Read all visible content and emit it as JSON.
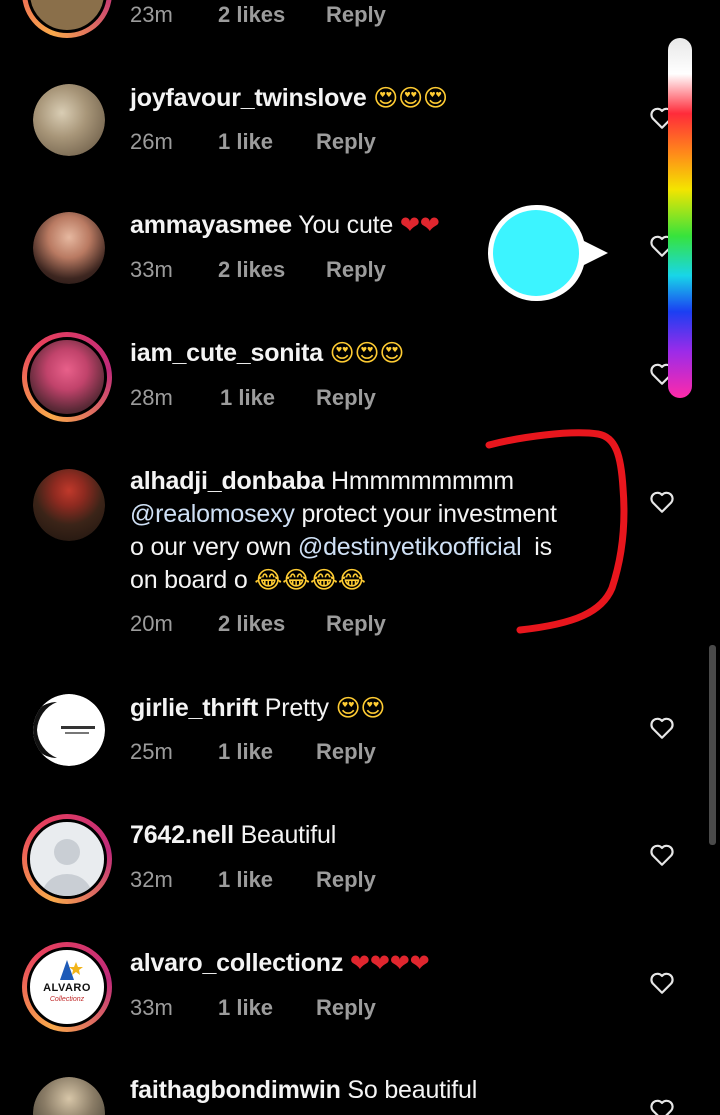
{
  "meta_labels": {
    "reply": "Reply"
  },
  "comments": [
    {
      "username": "",
      "text": "",
      "time": "23m",
      "likes": "2 likes",
      "reply": "Reply"
    },
    {
      "username": "joyfavour_twinslove",
      "text": "",
      "time": "26m",
      "likes": "1 like",
      "reply": "Reply"
    },
    {
      "username": "ammayasmee",
      "text": "You cute",
      "time": "33m",
      "likes": "2 likes",
      "reply": "Reply"
    },
    {
      "username": "iam_cute_sonita",
      "text": "",
      "time": "28m",
      "likes": "1 like",
      "reply": "Reply"
    },
    {
      "username": "alhadji_donbaba",
      "text_part1": "Hmmmmmmmm",
      "mention1": "@realomosexy",
      "text_part2": "protect your investment",
      "text_part3": "o our very own",
      "mention2": "@destinyetikoofficial",
      "text_part4": "is",
      "text_part5": "on board o",
      "time": "20m",
      "likes": "2 likes",
      "reply": "Reply"
    },
    {
      "username": "girlie_thrift",
      "text": "Pretty",
      "time": "25m",
      "likes": "1 like",
      "reply": "Reply"
    },
    {
      "username": "7642.nell",
      "text": "Beautiful",
      "time": "32m",
      "likes": "1 like",
      "reply": "Reply"
    },
    {
      "username": "alvaro_collectionz",
      "text": "",
      "time": "33m",
      "likes": "1 like",
      "reply": "Reply"
    },
    {
      "username": "faithagbondimwin",
      "text": "So beautiful"
    }
  ],
  "emojis": {
    "heart_eyes": "😍",
    "red_heart": "❤",
    "tears_of_joy": "😂"
  },
  "avatar_texts": {
    "alvaro_logo": "ALVARO",
    "alvaro_sub": "Collectionz"
  },
  "icons": {
    "like": "heart-outline-icon",
    "color_slider": "color-gradient-slider",
    "picker": "color-picker-bubble"
  },
  "colors": {
    "background": "#000000",
    "meta_text": "#9c9c9c",
    "picker_selected": "#3cf4ff",
    "annotation": "#e8161d"
  }
}
